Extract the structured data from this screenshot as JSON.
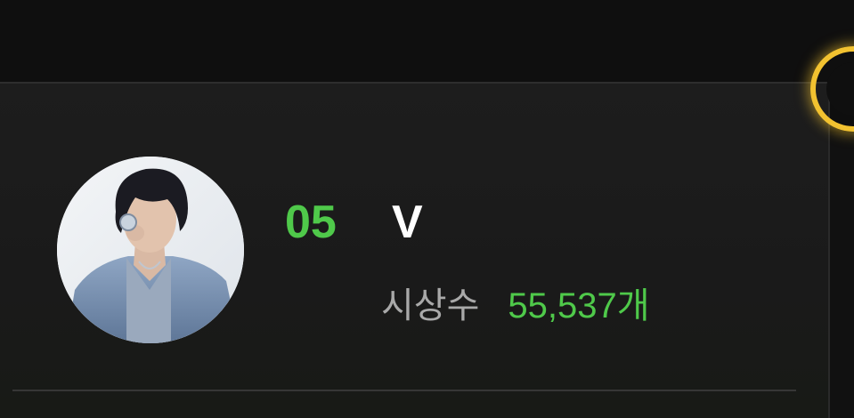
{
  "ranking_card": {
    "rank": "05",
    "artist_name": "V",
    "award_label": "시상수",
    "award_count": "55,537개"
  },
  "colors": {
    "accent_green": "#4fc94a",
    "highlight_gold": "#f2c230",
    "background": "#1a1a1a"
  },
  "icons": {
    "avatar": "artist-profile-photo",
    "badge": "gold-ring-badge"
  }
}
